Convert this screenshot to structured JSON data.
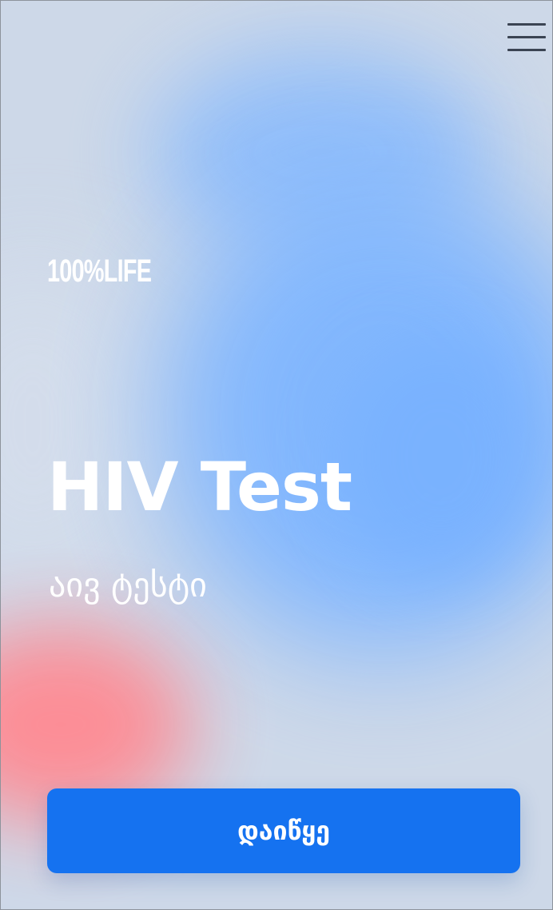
{
  "header": {
    "menu_icon": "hamburger-menu-icon"
  },
  "brand": {
    "logo_text": "100%LIFE"
  },
  "hero": {
    "title": "HIV Test",
    "subtitle": "აივ ტესტი"
  },
  "actions": {
    "start_label": "დაიწყე"
  },
  "colors": {
    "background": "#cdd8e8",
    "accent_blue": "#1572f0",
    "blob_blue": "#7fb6ff",
    "blob_red": "#ff8a92"
  }
}
